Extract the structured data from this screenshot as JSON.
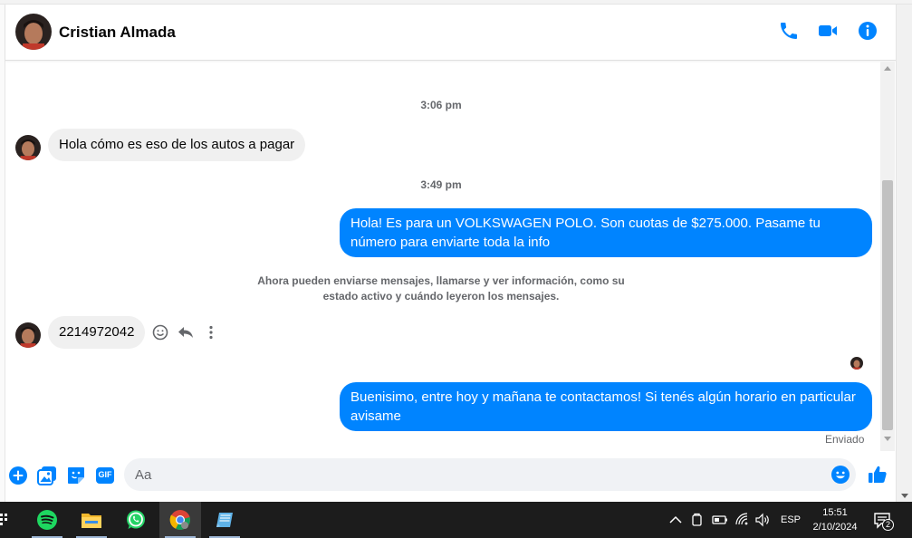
{
  "header": {
    "contact_name": "Cristian Almada",
    "icons": [
      "phone-icon",
      "video-camera-icon",
      "info-icon"
    ]
  },
  "colors": {
    "accent": "#0084ff",
    "incoming_bubble": "#f0f0f0",
    "meta_text": "#65676b",
    "taskbar": "#1c1c1c"
  },
  "conversation": {
    "timestamp_1": "3:06 pm",
    "msg_in_1": "Hola cómo es eso de los autos a pagar",
    "timestamp_2": "3:49 pm",
    "msg_out_1": "Hola! Es para un VOLKSWAGEN POLO. Son cuotas de $275.000. Pasame tu número para enviarte toda la info",
    "system_notice": "Ahora pueden enviarse mensajes, llamarse y ver información, como su estado activo y cuándo leyeron los mensajes.",
    "msg_in_2": "2214972042",
    "msg_in_2_actions": [
      "emoji-react-icon",
      "reply-icon",
      "more-options-icon"
    ],
    "msg_out_2": "Buenisimo, entre hoy y mañana te contactamos! Si tenés algún horario en particular avisame",
    "status": "Enviado"
  },
  "composer": {
    "placeholder": "Aa",
    "icons": [
      "add-icon",
      "image-icon",
      "sticker-icon",
      "gif-icon",
      "emoji-icon",
      "like-icon"
    ],
    "gif_label": "GIF"
  },
  "taskbar": {
    "apps": [
      "spotify-icon",
      "file-explorer-icon",
      "whatsapp-icon",
      "chrome-icon",
      "notepad-icon"
    ],
    "active_app": "chrome-icon",
    "language": "ESP",
    "time": "15:51",
    "date": "2/10/2024",
    "notification_count": "2"
  }
}
